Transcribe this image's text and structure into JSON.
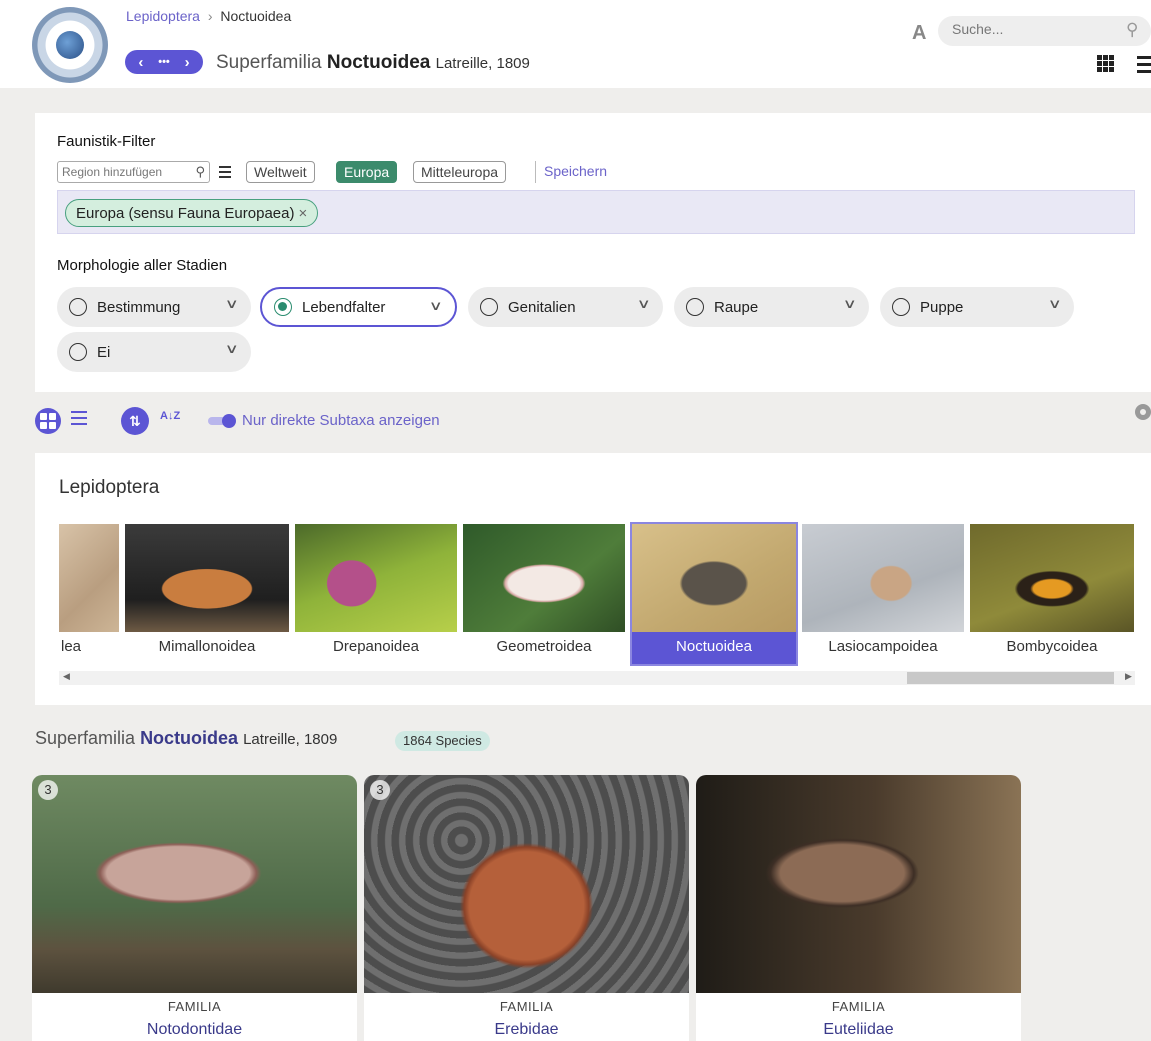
{
  "header": {
    "breadcrumb_parent": "Lepidoptera",
    "breadcrumb_sep": "›",
    "breadcrumb_current": "Noctuoidea",
    "rank": "Superfamilia",
    "taxon": "Noctuoidea",
    "author": "Latreille, 1809",
    "nav_prev": "‹",
    "nav_more": "•••",
    "nav_next": "›",
    "font_toggle": "A",
    "search_placeholder": "Suche..."
  },
  "filter": {
    "title": "Faunistik-Filter",
    "region_placeholder": "Region hinzufügen",
    "presets": [
      "Weltweit",
      "Europa",
      "Mitteleuropa"
    ],
    "active_preset": "Europa",
    "save_label": "Speichern",
    "selected_region": "Europa (sensu Fauna Europaea)",
    "remove_symbol": "×"
  },
  "morphology": {
    "title": "Morphologie aller Stadien",
    "options": [
      {
        "label": "Bestimmung",
        "selected": false
      },
      {
        "label": "Lebendfalter",
        "selected": true
      },
      {
        "label": "Genitalien",
        "selected": false
      },
      {
        "label": "Raupe",
        "selected": false
      },
      {
        "label": "Puppe",
        "selected": false
      },
      {
        "label": "Ei",
        "selected": false
      }
    ]
  },
  "toolbar": {
    "sort_icon_label": "⇅",
    "sort_alpha_label": "A↓Z",
    "direct_subtaxa_label": "Nur direkte Subtaxa anzeigen",
    "direct_subtaxa_on": true
  },
  "carousel": {
    "title": "Lepidoptera",
    "items": [
      {
        "label": "lea",
        "selected": false
      },
      {
        "label": "Mimallonoidea",
        "selected": false
      },
      {
        "label": "Drepanoidea",
        "selected": false
      },
      {
        "label": "Geometroidea",
        "selected": false
      },
      {
        "label": "Noctuoidea",
        "selected": true
      },
      {
        "label": "Lasiocampoidea",
        "selected": false
      },
      {
        "label": "Bombycoidea",
        "selected": false
      }
    ],
    "scroll_left": "◀",
    "scroll_right": "▶"
  },
  "taxon_section": {
    "rank": "Superfamilia",
    "name": "Noctuoidea",
    "author": "Latreille, 1809",
    "species_badge": "1864 Species"
  },
  "cards": [
    {
      "count": "3",
      "category": "FAMILIA",
      "name": "Notodontidae"
    },
    {
      "count": "3",
      "category": "FAMILIA",
      "name": "Erebidae"
    },
    {
      "count": "",
      "category": "FAMILIA",
      "name": "Euteliidae"
    }
  ],
  "colors": {
    "accent": "#5c55d4",
    "active_green": "#3c8b6c",
    "background": "#efeeec"
  }
}
